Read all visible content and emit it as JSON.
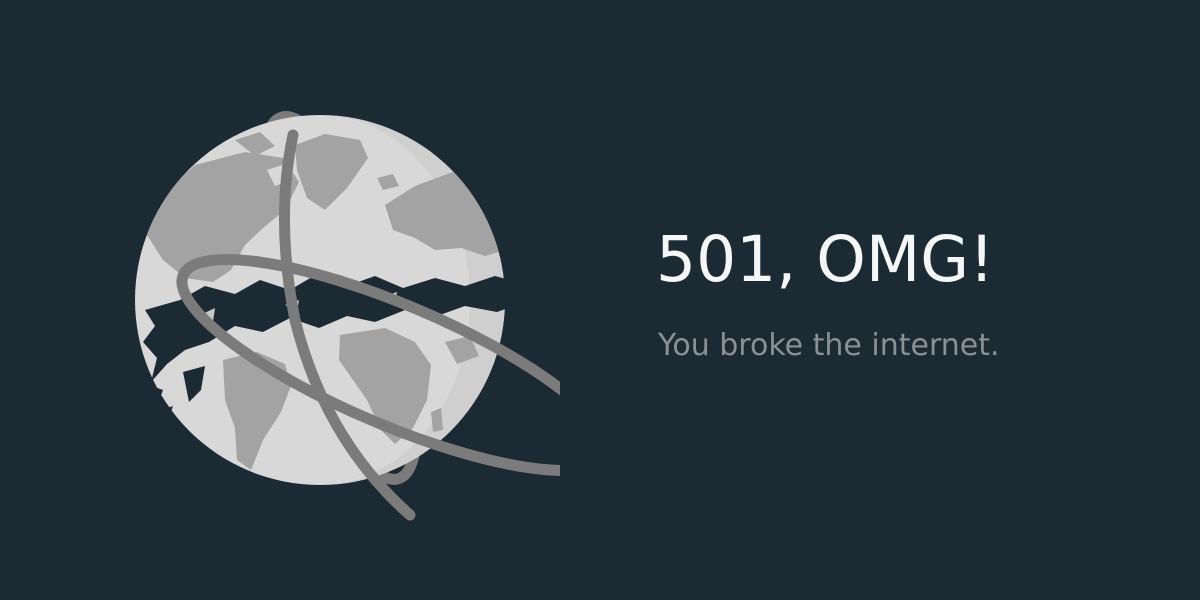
{
  "error": {
    "headline": "501, OMG!",
    "message": "You broke the internet."
  },
  "illustration": {
    "icon": "broken-globe-icon"
  },
  "colors": {
    "background": "#1c2a33",
    "headline": "#f4f6f7",
    "message": "#8a9196",
    "globe": "#d9d9d9",
    "land": "#a4a4a4",
    "orbit": "#7c7b7b"
  }
}
